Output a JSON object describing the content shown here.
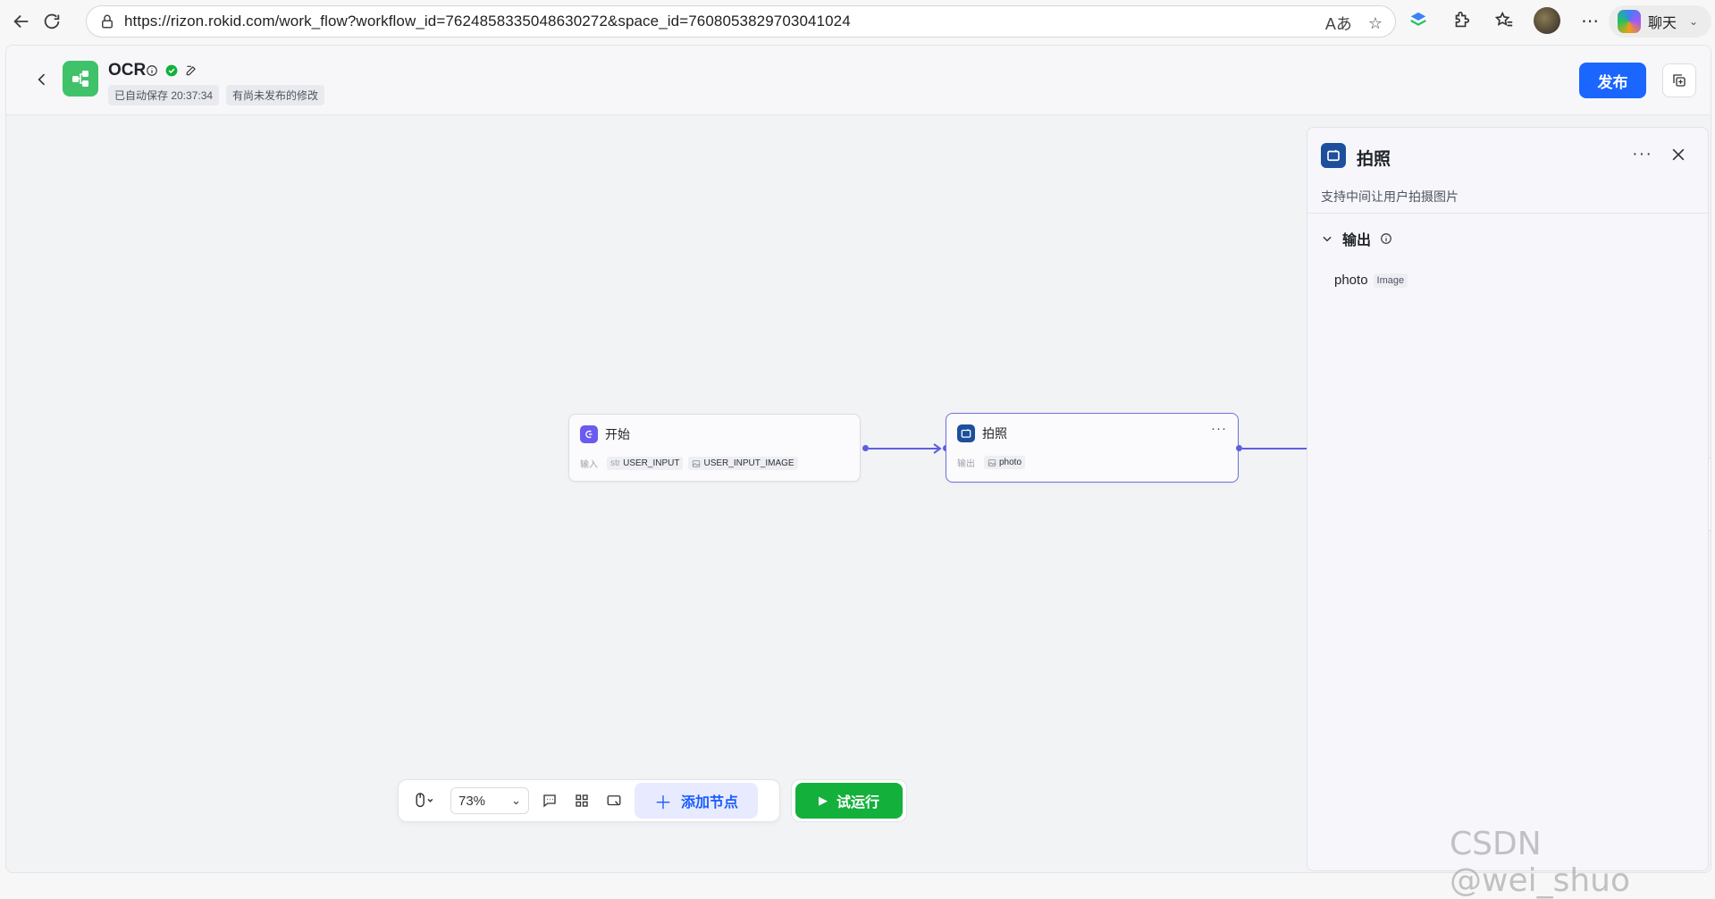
{
  "browser": {
    "url": "https://rizon.rokid.com/work_flow?workflow_id=7624858335048630272&space_id=7608053829703041024",
    "chat_label": "聊天"
  },
  "header": {
    "title": "OCR",
    "autosave": "已自动保存 20:37:34",
    "unpublished": "有尚未发布的修改",
    "publish_label": "发布"
  },
  "nodes": {
    "start": {
      "title": "开始",
      "row_label": "输入",
      "params": [
        {
          "prefix": "str",
          "name": "USER_INPUT"
        },
        {
          "prefix": "",
          "name": "USER_INPUT_IMAGE"
        }
      ]
    },
    "photo": {
      "title": "拍照",
      "row_label": "输出",
      "params": [
        {
          "name": "photo"
        }
      ]
    }
  },
  "panel": {
    "title": "拍照",
    "description": "支持中间让用户拍摄图片",
    "section_title": "输出",
    "outputs": [
      {
        "name": "photo",
        "type": "Image"
      }
    ]
  },
  "toolbar": {
    "zoom": "73%",
    "add_node_label": "添加节点",
    "run_label": "试运行"
  },
  "watermark": "CSDN @wei_shuo",
  "colors": {
    "publish": "#1b66ff",
    "run": "#13b13b",
    "app_logo": "#3fc26a",
    "edge": "#5c5fe0"
  }
}
